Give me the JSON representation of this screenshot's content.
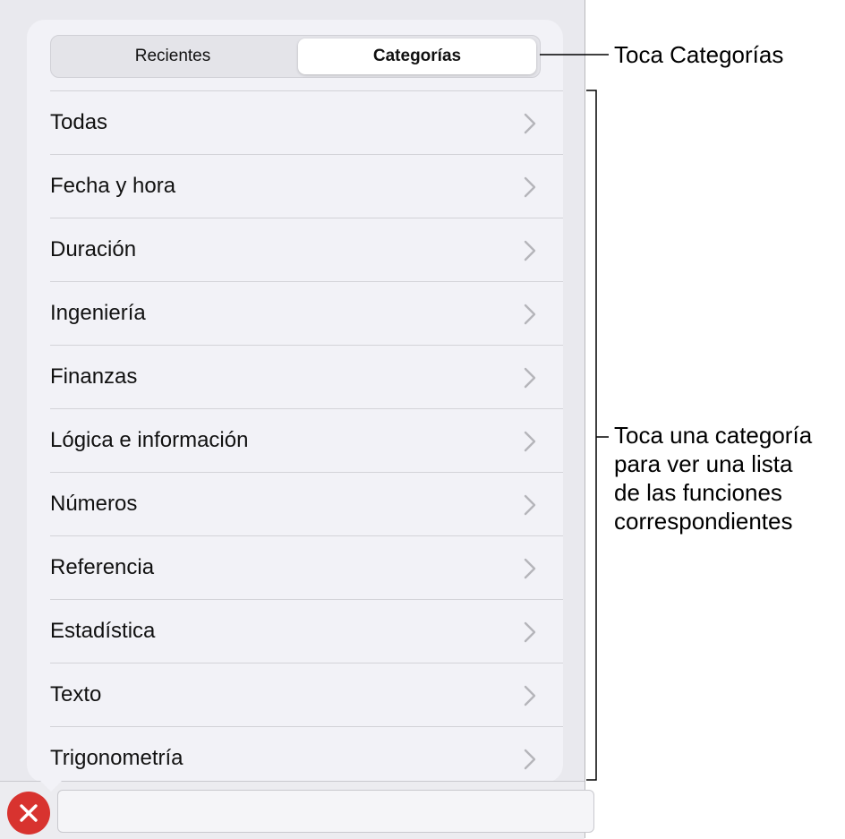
{
  "segmented": {
    "recent_label": "Recientes",
    "categories_label": "Categorías",
    "selected": "Categorías"
  },
  "categories": [
    {
      "label": "Todas"
    },
    {
      "label": "Fecha y hora"
    },
    {
      "label": "Duración"
    },
    {
      "label": "Ingeniería"
    },
    {
      "label": "Finanzas"
    },
    {
      "label": "Lógica e información"
    },
    {
      "label": "Números"
    },
    {
      "label": "Referencia"
    },
    {
      "label": "Estadística"
    },
    {
      "label": "Texto"
    },
    {
      "label": "Trigonometría"
    }
  ],
  "callouts": {
    "tap_categories": "Toca Categorías",
    "tap_category_lines": [
      "Toca una categoría",
      "para ver una lista",
      "de las funciones",
      "correspondientes"
    ]
  },
  "icons": {
    "row_chevron": "chevron-right-icon",
    "close": "close-icon"
  },
  "colors": {
    "close_button": "#d8332f",
    "popover_bg": "#f2f2f7",
    "chevron": "#b5b5ba"
  },
  "input": {
    "value": "",
    "placeholder": ""
  }
}
